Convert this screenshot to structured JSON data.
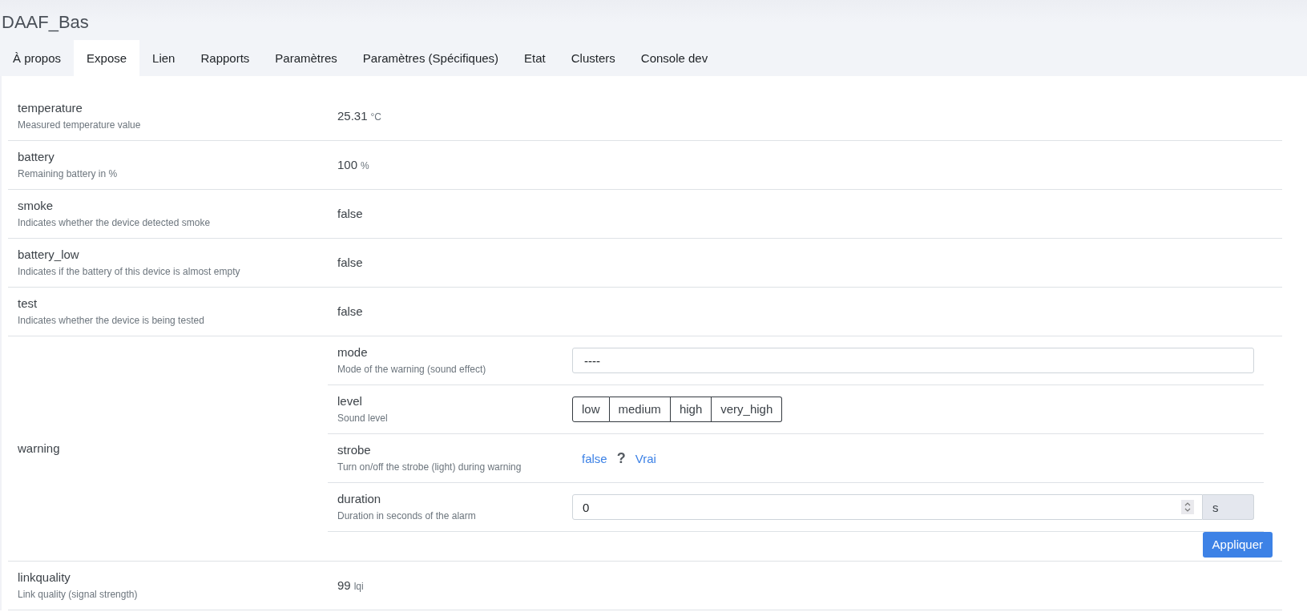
{
  "title": "DAAF_Bas",
  "tabs": [
    {
      "label": "À propos",
      "selected": false
    },
    {
      "label": "Expose",
      "selected": true
    },
    {
      "label": "Lien",
      "selected": false
    },
    {
      "label": "Rapports",
      "selected": false
    },
    {
      "label": "Paramètres",
      "selected": false
    },
    {
      "label": "Paramètres (Spécifiques)",
      "selected": false
    },
    {
      "label": "Etat",
      "selected": false
    },
    {
      "label": "Clusters",
      "selected": false
    },
    {
      "label": "Console dev",
      "selected": false
    }
  ],
  "exposes": [
    {
      "kind": "value",
      "name": "temperature",
      "description": "Measured temperature value",
      "value": "25.31",
      "unit": "°C"
    },
    {
      "kind": "value",
      "name": "battery",
      "description": "Remaining battery in %",
      "value": "100",
      "unit": "%"
    },
    {
      "kind": "value",
      "name": "smoke",
      "description": "Indicates whether the device detected smoke",
      "value": "false"
    },
    {
      "kind": "value",
      "name": "battery_low",
      "description": "Indicates if the battery of this device is almost empty",
      "value": "false"
    },
    {
      "kind": "value",
      "name": "test",
      "description": "Indicates whether the device is being tested",
      "value": "false"
    },
    {
      "kind": "composite",
      "name": "warning",
      "apply_label": "Appliquer",
      "features": [
        {
          "kind": "select",
          "name": "mode",
          "description": "Mode of the warning (sound effect)",
          "value": "----"
        },
        {
          "kind": "enum",
          "name": "level",
          "description": "Sound level",
          "options": [
            {
              "label": "low",
              "selected": false
            },
            {
              "label": "medium",
              "selected": false
            },
            {
              "label": "high",
              "selected": false
            },
            {
              "label": "very_high",
              "selected": false
            }
          ]
        },
        {
          "kind": "toggle",
          "name": "strobe",
          "description": "Turn on/off the strobe (light) during warning",
          "off_label": "false",
          "state": "?",
          "on_label": "Vrai"
        },
        {
          "kind": "number",
          "name": "duration",
          "description": "Duration in seconds of the alarm",
          "value": "0",
          "unit": "s"
        }
      ]
    },
    {
      "kind": "value",
      "name": "linkquality",
      "description": "Link quality (signal strength)",
      "value": "99",
      "unit": "lqi"
    }
  ]
}
